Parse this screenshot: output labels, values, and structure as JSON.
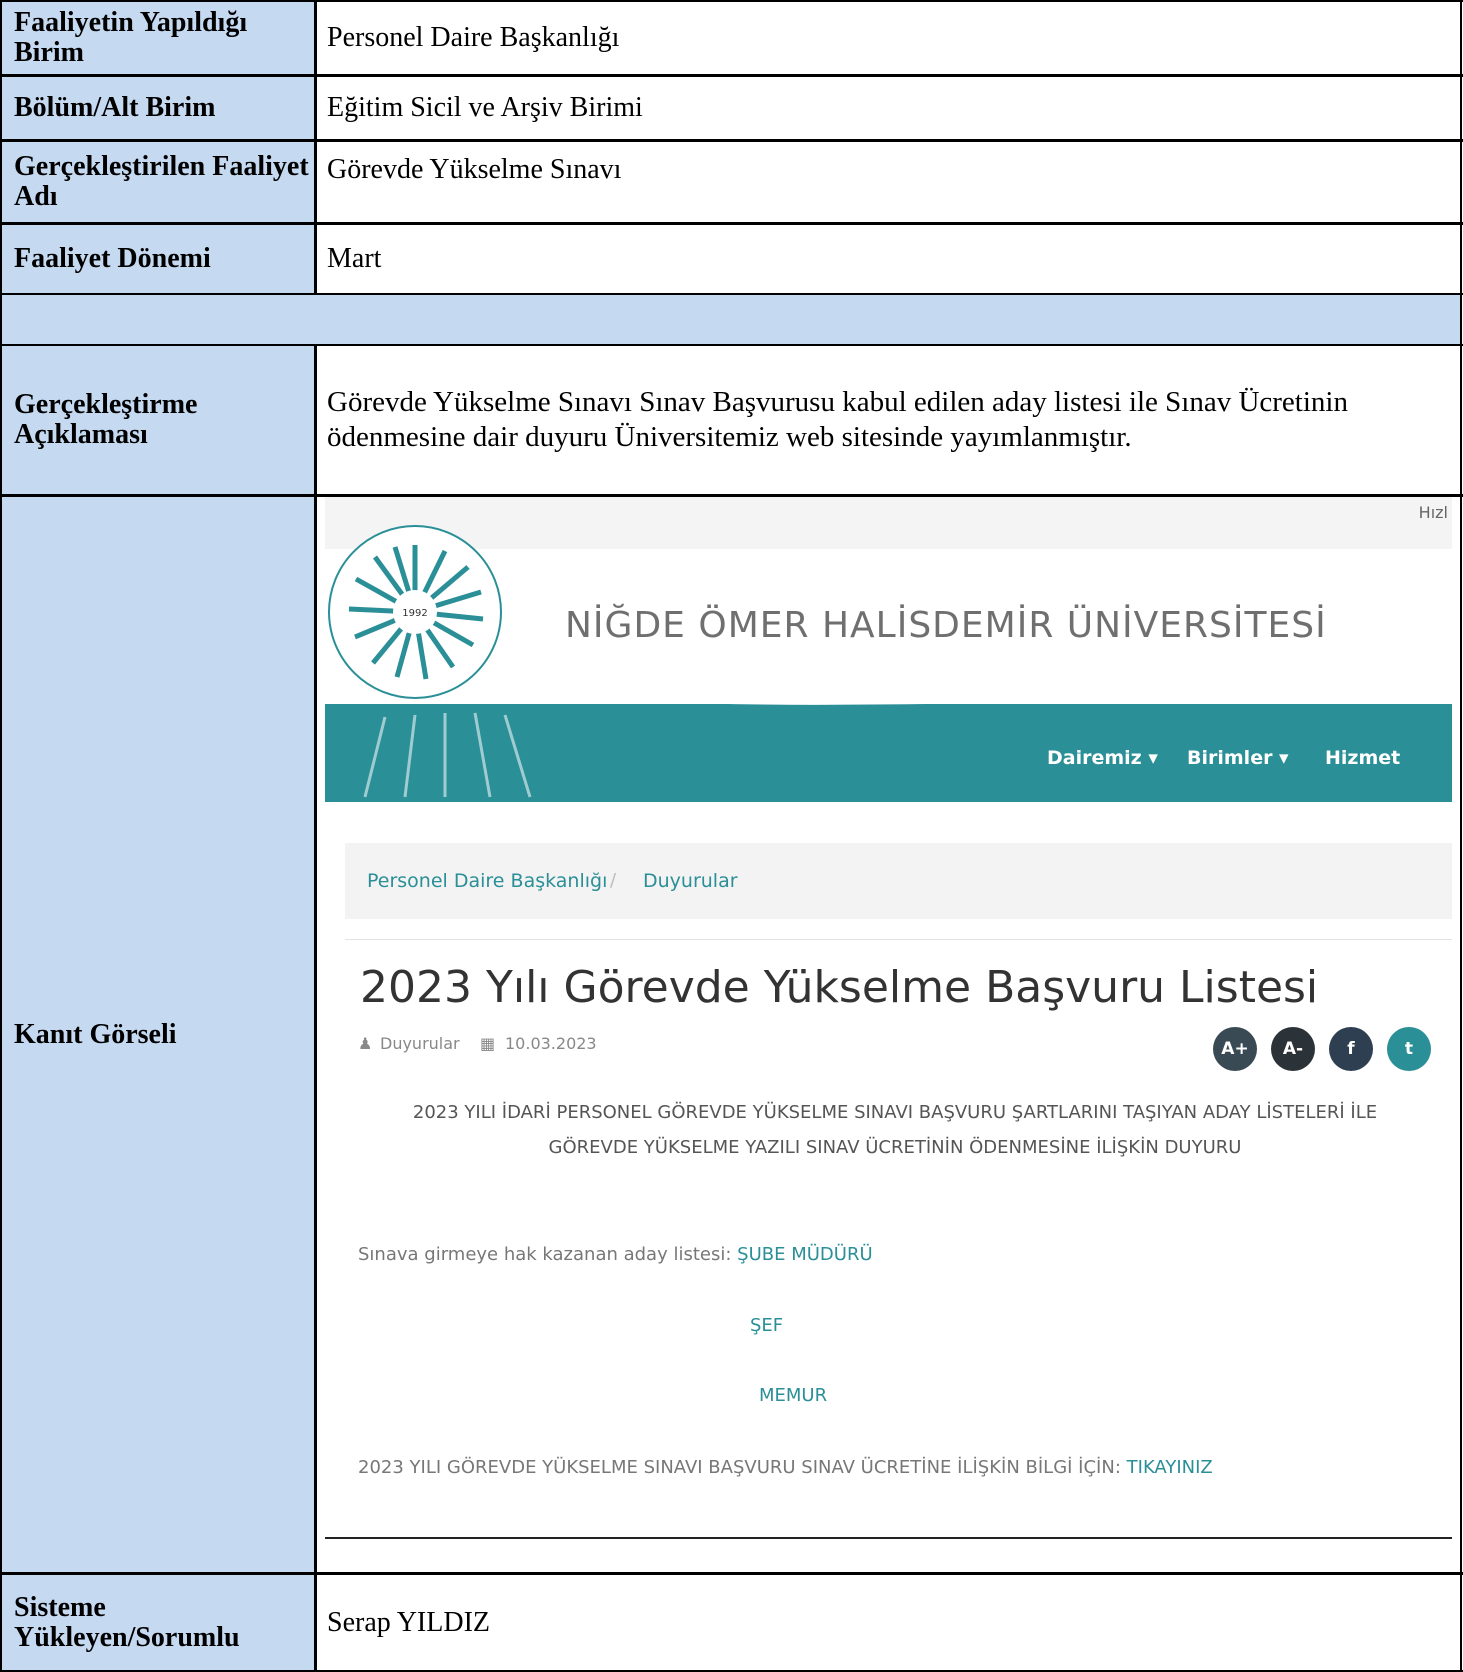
{
  "rows": {
    "birim": {
      "label": "Faaliyetin Yapıldığı Birim",
      "value": "Personel Daire Başkanlığı"
    },
    "alt_birim": {
      "label": "Bölüm/Alt Birim",
      "value": "Eğitim Sicil ve Arşiv Birimi"
    },
    "faaliyet_adi": {
      "label": "Gerçekleştirilen Faaliyet Adı",
      "value": "Görevde Yükselme Sınavı"
    },
    "donem": {
      "label": "Faaliyet Dönemi",
      "value": "Mart"
    },
    "aciklama": {
      "label": "Gerçekleştirme Açıklaması",
      "value": "Görevde Yükselme Sınavı Sınav Başvurusu kabul edilen aday listesi ile Sınav Ücretinin ödenmesine dair duyuru Üniversitemiz web sitesinde yayımlanmıştır."
    },
    "kanit": {
      "label": "Kanıt Görseli"
    },
    "sorumlu": {
      "label": "Sisteme Yükleyen/Sorumlu",
      "value": "Serap YILDIZ"
    }
  },
  "screenshot": {
    "top_right_text": "Hızl",
    "logo_year": "1992",
    "logo_ring_text": "NİĞDE ÖMER HALİSDEMİR ÜNİVERSİTESİ",
    "university_name": "NİĞDE ÖMER HALİSDEMİR ÜNİVERSİTESİ",
    "nav": [
      "Dairemiz ▾",
      "Birimler ▾",
      "Hizmet"
    ],
    "breadcrumb": [
      "Personel Daire Başkanlığı",
      "/",
      "Duyurular"
    ],
    "title": "2023 Yılı Görevde Yükselme Başvuru Listesi",
    "meta_category": "Duyurular",
    "meta_date": "10.03.2023",
    "share_buttons": [
      "A+",
      "A-",
      "f",
      "t"
    ],
    "notice_line1": "2023 YILI İDARİ PERSONEL GÖREVDE YÜKSELME SINAVI BAŞVURU ŞARTLARINI TAŞIYAN ADAY LİSTELERİ İLE",
    "notice_line2": "GÖREVDE YÜKSELME YAZILI SINAV ÜCRETİNİN ÖDENMESİNE İLİŞKİN DUYURU",
    "candidate_list_label": "Sınava girmeye hak kazanan aday listesi:",
    "link_sube": "ŞUBE MÜDÜRÜ",
    "link_sef": "ŞEF",
    "link_memur": "MEMUR",
    "fee_info_label": "2023 YILI GÖREVDE YÜKSELME SINAVI BAŞVURU SINAV ÜCRETİNE İLİŞKİN BİLGİ İÇİN:",
    "fee_link": "TIKAYINIZ",
    "colors": {
      "teal": "#2a8f97",
      "label_bg": "#c5d9f1"
    }
  }
}
